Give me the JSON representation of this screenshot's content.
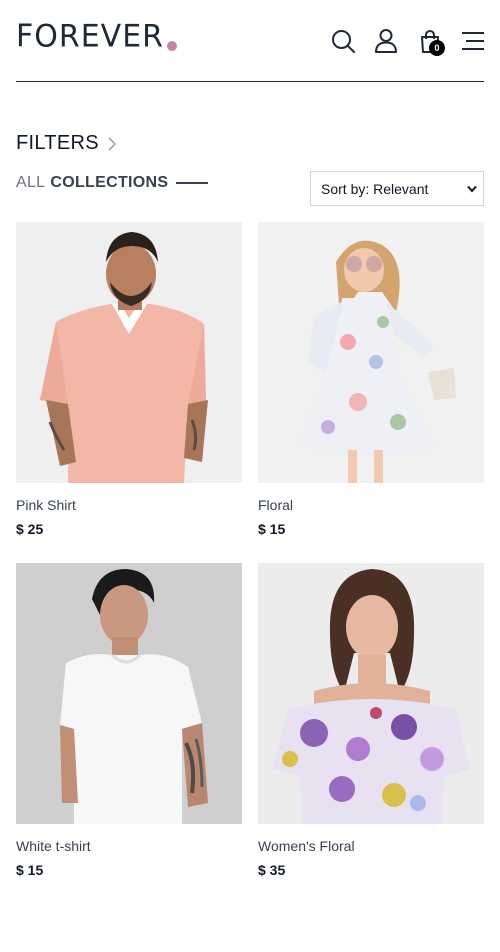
{
  "header": {
    "logo_text": "FOREVER",
    "logo_dot_color": "#c586a5",
    "icons": [
      "search-icon",
      "user-icon",
      "cart-icon",
      "menu-icon"
    ],
    "cart_count": "0"
  },
  "filters": {
    "label": "FILTERS"
  },
  "collections": {
    "word1": "ALL",
    "word2": "COLLECTIONS"
  },
  "sort": {
    "selected": "Sort by: Relevant"
  },
  "products": [
    {
      "name": "Pink Shirt",
      "price": "$ 25"
    },
    {
      "name": "Floral",
      "price": "$ 15"
    },
    {
      "name": "White t-shirt",
      "price": "$ 15"
    },
    {
      "name": "Women's Floral",
      "price": "$ 35"
    }
  ]
}
